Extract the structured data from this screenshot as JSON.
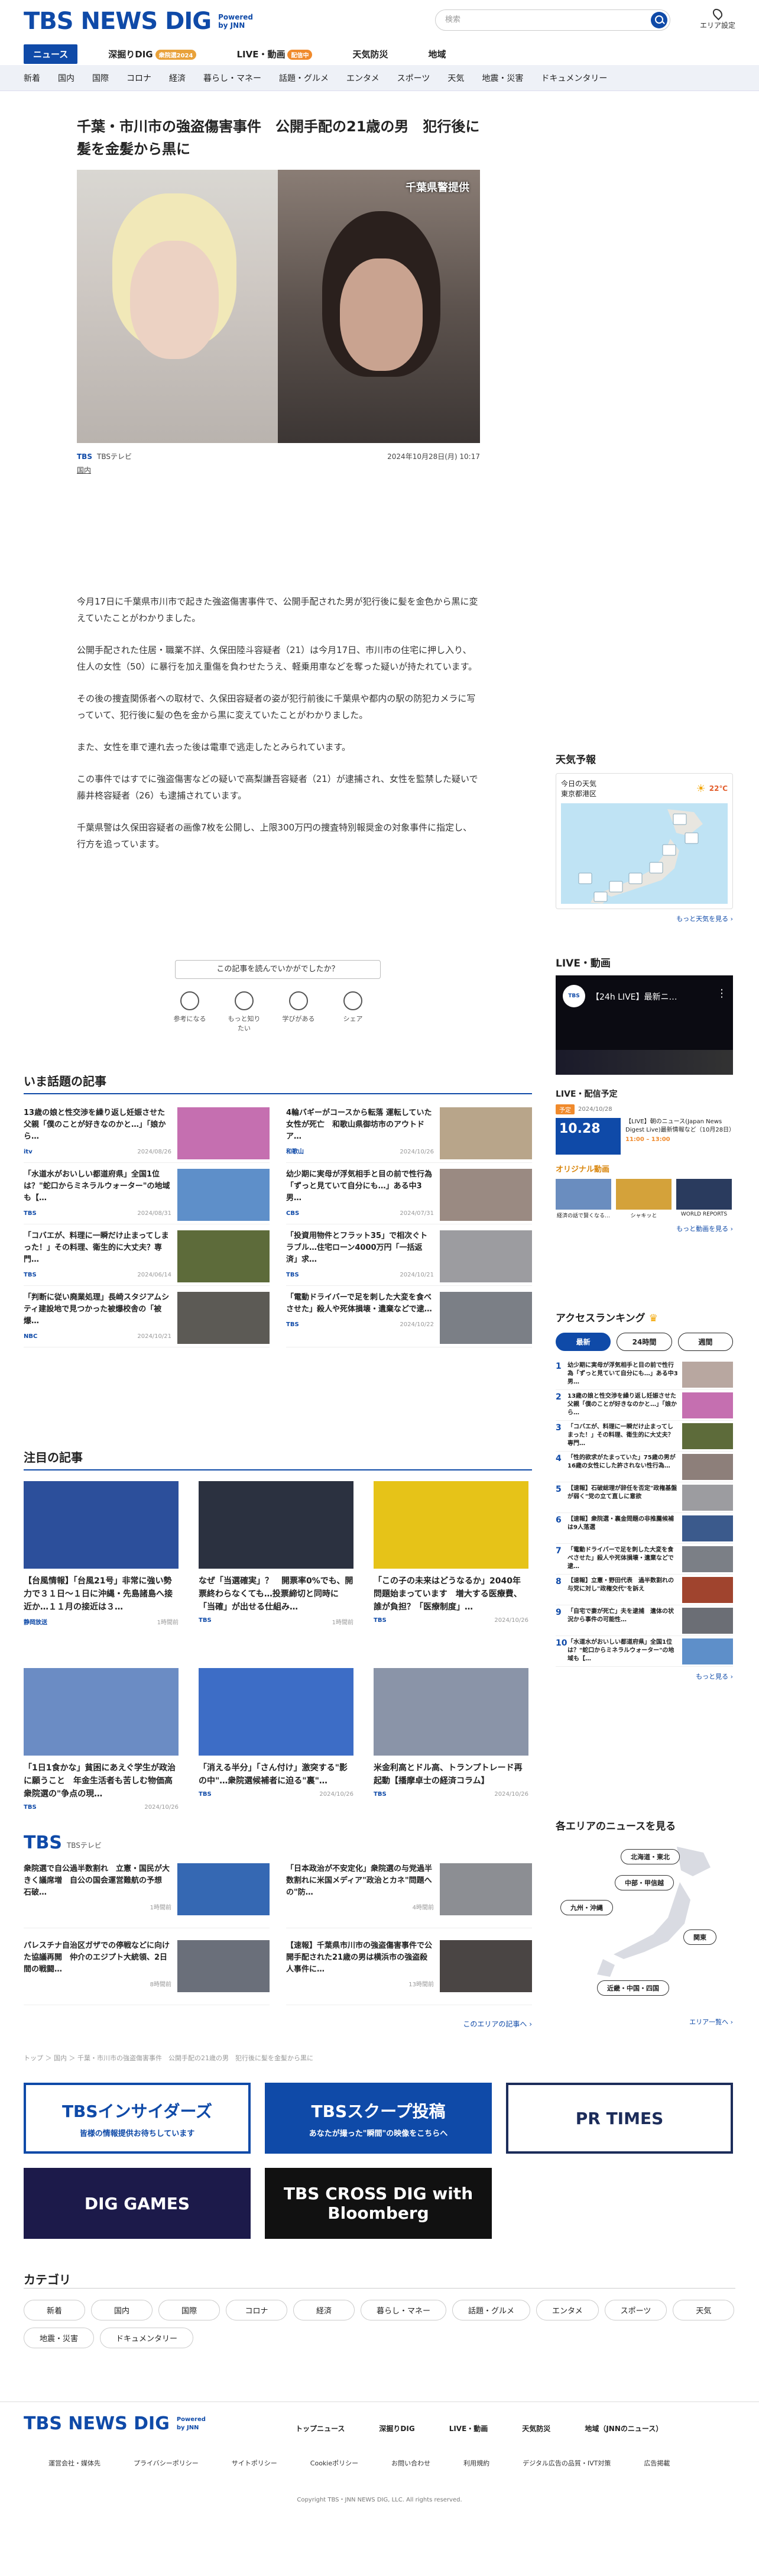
{
  "header": {
    "logo": "TBS NEWS DIG",
    "powered": "Powered",
    "by": "by JNN",
    "search_placeholder": "検索",
    "area_label": "エリア設定"
  },
  "nav_tabs": [
    {
      "label": "ニュース",
      "badge": ""
    },
    {
      "label": "深掘りDIG",
      "badge": "衆院選2024"
    },
    {
      "label": "LIVE・動画",
      "badge": "配信中"
    },
    {
      "label": "天気防災",
      "badge": ""
    },
    {
      "label": "地域",
      "badge": ""
    }
  ],
  "categories_nav": [
    "新着",
    "国内",
    "国際",
    "コロナ",
    "経済",
    "暮らし・マネー",
    "話題・グルメ",
    "エンタメ",
    "スポーツ",
    "天気",
    "地震・災害",
    "ドキュメンタリー"
  ],
  "article": {
    "title": "千葉・市川市の強盗傷害事件　公開手配の21歳の男　犯行後に髪を金髪から黒に",
    "photo_credit": "千葉県警提供",
    "source": "TBSテレビ",
    "date": "2024年10月28日(月) 10:17",
    "category": "国内",
    "paragraphs": [
      "今月17日に千葉県市川市で起きた強盗傷害事件で、公開手配された男が犯行後に髪を金色から黒に変えていたことがわかりました。",
      "公開手配された住居・職業不詳、久保田陸斗容疑者（21）は今月17日、市川市の住宅に押し入り、住人の女性（50）に暴行を加え重傷を負わせたうえ、軽乗用車などを奪った疑いが持たれています。",
      "その後の捜査関係者への取材で、久保田容疑者の姿が犯行前後に千葉県や都内の駅の防犯カメラに写っていて、犯行後に髪の色を金から黒に変えていたことがわかりました。",
      "また、女性を車で連れ去った後は電車で逃走したとみられています。",
      "この事件ではすでに強盗傷害などの疑いで高梨謙吾容疑者（21）が逮捕され、女性を監禁した疑いで藤井柊容疑者（26）も逮捕されています。",
      "千葉県警は久保田容疑者の画像7枚を公開し、上限300万円の捜査特別報奨金の対象事件に指定し、行方を追っています。"
    ],
    "read_more": "この記事を読んでいかがでしたか？",
    "reactions": [
      "参考になる",
      "もっと知りたい",
      "学びがある",
      "シェア"
    ]
  },
  "trending": {
    "title": "いま話題の記事",
    "items": [
      {
        "text": "13歳の娘と性交渉を繰り返し妊娠させた父親「僕のことが好きなのかと…」「娘から…",
        "source": "itv",
        "date": "2024/08/26",
        "thumb": "#c56fb0"
      },
      {
        "text": "4輪バギーがコースから転落 運転していた女性が死亡　和歌山県御坊市のアウトドア…",
        "source": "和歌山",
        "date": "2024/10/26",
        "thumb": "#b8a58a"
      },
      {
        "text": "「水道水がおいしい都道府県」全国1位は？\"蛇口からミネラルウォーター\"の地域も【…",
        "source": "TBS",
        "date": "2024/08/31",
        "thumb": "#5e8fc9"
      },
      {
        "text": "幼少期に実母が浮気相手と目の前で性行為「ずっと見ていて自分にも…」ある中3男…",
        "source": "CBS",
        "date": "2024/07/31",
        "thumb": "#9a8a82"
      },
      {
        "text": "「コバエが、料理に一瞬だけ止まってしまった！」その料理、衛生的に大丈夫？専門…",
        "source": "TBS",
        "date": "2024/06/14",
        "thumb": "#5d6b3a"
      },
      {
        "text": "「投資用物件とフラット35」で相次ぐトラブル…住宅ローン4000万円「一括返済」求…",
        "source": "TBS",
        "date": "2024/10/21",
        "thumb": "#9c9ca0"
      },
      {
        "text": "「判断に従い廃業処理」長崎スタジアムシティ建設地で見つかった被爆校舎の「被爆…",
        "source": "NBC",
        "date": "2024/10/21",
        "thumb": "#5c5a55"
      },
      {
        "text": "「電動ドライバーで足を刺した大変を食べさせた」殺人や死体損壊・遺棄などで逮…",
        "source": "TBS",
        "date": "2024/10/22",
        "thumb": "#7b7f86"
      }
    ]
  },
  "featured": {
    "title": "注目の記事",
    "items": [
      {
        "text": "【台風情報】「台風21号」非常に強い勢力で３１日〜１日に沖縄・先島諸島へ接近か…１１月の接近は３…",
        "source": "静岡放送",
        "date": "1時間前",
        "thumb": "#2c4f9b"
      },
      {
        "text": "なぜ「当選確実」？　開票率0%でも、開票終わらなくても…投票締切と同時に「当確」が出せる仕組み…",
        "source": "TBS",
        "date": "1時間前",
        "thumb": "#2b3140"
      },
      {
        "text": "「この子の未来はどうなるか」2040年問題始まっています　増大する医療費、誰が負担？「医療制度」…",
        "source": "TBS",
        "date": "2024/10/26",
        "thumb": "#e6c318"
      },
      {
        "text": "「1日1食かな」貧困にあえぐ学生が政治に願うこと　年金生活者も苦しむ物価高　衆院選の\"争点の現…",
        "source": "TBS",
        "date": "2024/10/26",
        "thumb": "#6b8cc4"
      },
      {
        "text": "「消える半分」「さん付け」激突する\"影の中\"…衆院選候補者に迫る\"裏\"…",
        "source": "TBS",
        "date": "2024/10/26",
        "thumb": "#3d6dc6"
      },
      {
        "text": "米金利高とドル高、トランプトレード再起動【播摩卓士の経済コラム】",
        "source": "TBS",
        "date": "2024/10/26",
        "thumb": "#8a94a8"
      }
    ]
  },
  "tbs_section": {
    "label": "TBSテレビ",
    "items": [
      {
        "text": "衆院選で自公過半数割れ　立憲・国民が大きく議席増　自公の国会運営難航の予想　石破…",
        "date": "1時間前",
        "thumb": "#3568b3"
      },
      {
        "text": "「日本政治が不安定化」衆院選の与党過半数割れに米国メディア\"政治とカネ\"問題への\"防…",
        "date": "4時間前",
        "thumb": "#8c8e93"
      },
      {
        "text": "パレスチナ自治区ガザでの停戦などに向けた協議再開　仲介のエジプト大統領、2日間の戦闘…",
        "date": "8時間前",
        "thumb": "#6a6f7a"
      },
      {
        "text": "【速報】千葉県市川市の強盗傷害事件で公開手配された21歳の男は横浜市の強盗殺人事件に…",
        "date": "13時間前",
        "thumb": "#4a4544"
      }
    ],
    "more": "このエリアの記事へ ›"
  },
  "weather": {
    "title": "天気予報",
    "today_label": "今日の天気",
    "place": "東京都港区",
    "temp": "22℃",
    "more": "もっと天気を見る ›"
  },
  "live": {
    "title": "LIVE・動画",
    "video_title": "【24h LIVE】最新ニ…",
    "schedule_title": "LIVE・配信予定",
    "schedule_badge": "予定",
    "schedule_date": "2024/10/28",
    "schedule_day": "10.28",
    "schedule_text": "【LIVE】朝のニュース(Japan News Digest Live)最新情報など（10月28日）",
    "schedule_time": "11:00 – 13:00",
    "original_title": "オリジナル動画",
    "originals": [
      "経済の話で賢くなる…",
      "シャキッと",
      "WORLD REPORTS"
    ],
    "more": "もっと動画を見る ›"
  },
  "ranking": {
    "title": "アクセスランキング",
    "tabs": [
      "最新",
      "24時間",
      "週間"
    ],
    "items": [
      "幼少期に実母が浮気相手と目の前で性行為「ずっと見ていて自分にも…」ある中3男…",
      "13歳の娘と性交渉を繰り返し妊娠させた父親「僕のことが好きなのかと…」「娘から…",
      "「コバエが、料理に一瞬だけ止まってしまった！」その料理、衛生的に大丈夫？専門…",
      "「性的欲求がたまっていた」75歳の男が16歳の女性にした許されない性行為…",
      "【速報】石破総理が辞任を否定\"政権基盤が弱く\"党の立て直しに意欲",
      "【速報】衆院選・裏金問題の非推薦候補は9人落選",
      "「電動ドライバーで足を刺した大変を食べさせた」殺人や死体損壊・遺棄などで逮…",
      "【速報】立憲・野田代表　過半数割れの与党に対し\"政権交代\"を訴え",
      "「自宅で妻が死亡」夫を逮捕　遺体の状況から事件の可能性…",
      "「水道水がおいしい都道府県」全国1位は？\"蛇口からミネラルウォーター\"の地域も【…"
    ],
    "more": "もっと見る ›"
  },
  "areas": {
    "title": "各エリアのニュースを見る",
    "buttons": [
      "北海道・東北",
      "中部・甲信越",
      "九州・沖縄",
      "関東",
      "近畿・中国・四国"
    ],
    "more": "エリア一覧へ ›"
  },
  "breadcrumb": "トップ ＞ 国内 ＞ 千葉・市川市の強盗傷害事件　公開手配の21歳の男　犯行後に髪を金髪から黒に",
  "banners": [
    {
      "label": "TBSインサイダーズ",
      "sub": "皆様の情報提供お待ちしています",
      "bg": "#ffffff",
      "fg": "#0f4aa8"
    },
    {
      "label": "TBSスクープ投稿",
      "sub": "あなたが撮った\"瞬間\"の映像をこちらへ",
      "bg": "#0f4aa8",
      "fg": "#ffffff"
    },
    {
      "label": "PR TIMES",
      "sub": "",
      "bg": "#ffffff",
      "fg": "#1c2c5a"
    },
    {
      "label": "DIG GAMES",
      "sub": "",
      "bg": "#1c1a4a",
      "fg": "#ffffff"
    },
    {
      "label": "TBS CROSS DIG with Bloomberg",
      "sub": "",
      "bg": "#111111",
      "fg": "#ffffff"
    }
  ],
  "category_section": {
    "title": "カテゴリ",
    "items": [
      "新着",
      "国内",
      "国際",
      "コロナ",
      "経済",
      "暮らし・マネー",
      "話題・グルメ",
      "エンタメ",
      "スポーツ",
      "天気",
      "地震・災害",
      "ドキュメンタリー"
    ]
  },
  "footer": {
    "logo": "TBS NEWS DIG",
    "main_links": [
      "トップニュース",
      "深掘りDIG",
      "LIVE・動画",
      "天気防災",
      "地域（JNNのニュース）"
    ],
    "sub_links": [
      "運営会社・媒体先",
      "プライバシーポリシー",
      "サイトポリシー",
      "Cookieポリシー",
      "お問い合わせ",
      "利用規約",
      "デジタル広告の品質・IVT対策",
      "広告掲載"
    ],
    "copyright": "Copyright TBS・JNN NEWS DIG, LLC. All rights reserved."
  }
}
